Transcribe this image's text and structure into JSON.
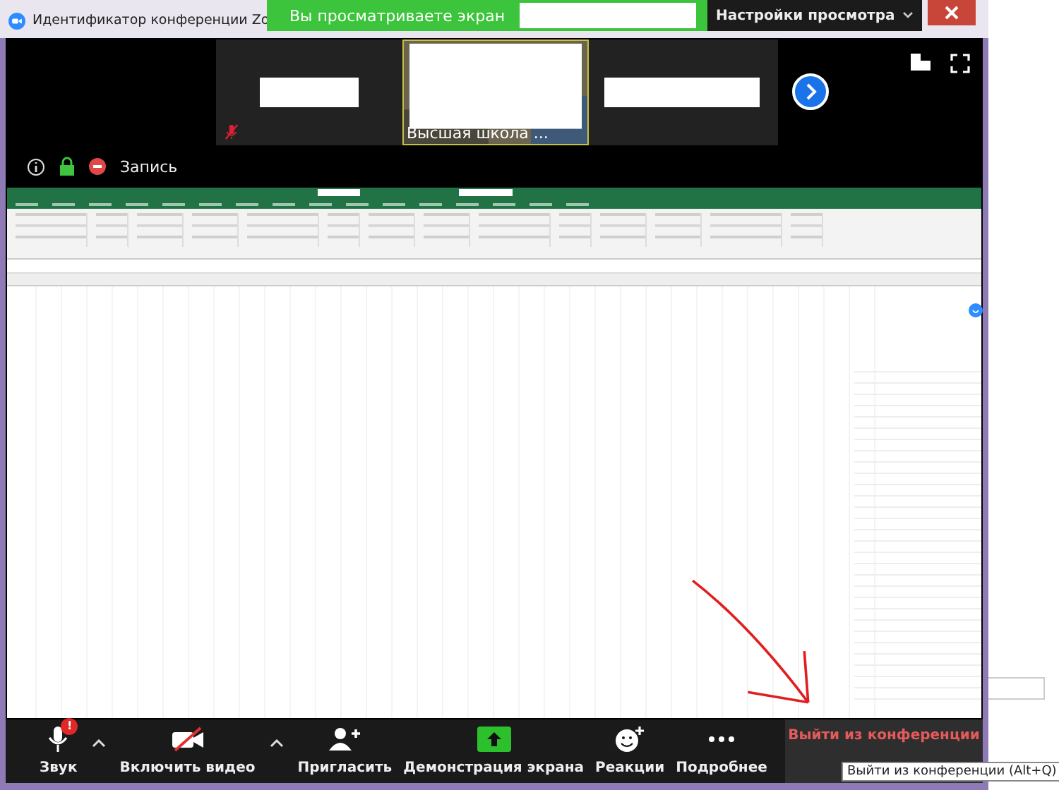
{
  "window": {
    "title": "Идентификатор конференции Zo"
  },
  "banner": {
    "text": "Вы просматриваете экран",
    "view_settings": "Настройки просмотра"
  },
  "thumbnails": [
    {
      "kind": "redacted",
      "active": false,
      "muted": true
    },
    {
      "kind": "video",
      "active": true,
      "muted": false,
      "caption": "Высшая школа ..."
    },
    {
      "kind": "redacted",
      "active": false,
      "muted": false
    }
  ],
  "meeting_info": {
    "recording": "Запись"
  },
  "toolbar": [
    {
      "kind": "audio",
      "label": "Звук",
      "badge": "!",
      "menu": true
    },
    {
      "kind": "video",
      "label": "Включить видео",
      "menu": true
    },
    {
      "kind": "invite",
      "label": "Пригласить",
      "menu": false
    },
    {
      "kind": "share",
      "label": "Демонстрация экрана",
      "menu": false
    },
    {
      "kind": "reactions",
      "label": "Реакции",
      "menu": false
    },
    {
      "kind": "more",
      "label": "Подробнее",
      "menu": false
    }
  ],
  "leave_button": "Выйти из конференции",
  "tooltip": "Выйти из конференции (Alt+Q)"
}
